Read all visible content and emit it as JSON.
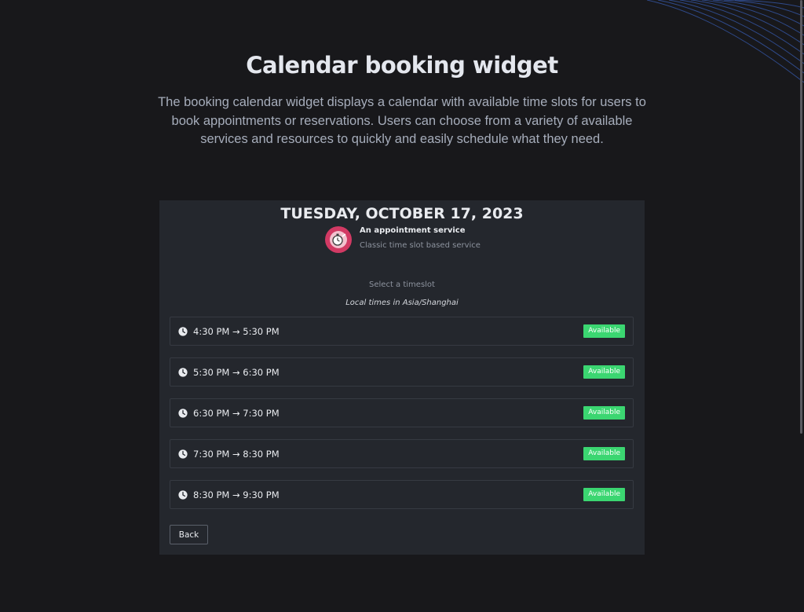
{
  "hero": {
    "title": "Calendar booking widget",
    "description": "The booking calendar widget displays a calendar with available time slots for users to book appointments or reservations. Users can choose from a variety of available services and resources to quickly and easily schedule what they need."
  },
  "widget": {
    "date_heading": "TUESDAY, OCTOBER 17, 2023",
    "service": {
      "name": "An appointment service",
      "subtitle": "Classic time slot based service",
      "avatar_icon": "stopwatch-icon",
      "avatar_color": "#d23a64"
    },
    "select_label": "Select a timeslot",
    "timezone_label": "Local times in Asia/Shanghai",
    "slots": [
      {
        "time": "4:30 PM → 5:30 PM",
        "status": "Available"
      },
      {
        "time": "5:30 PM → 6:30 PM",
        "status": "Available"
      },
      {
        "time": "6:30 PM → 7:30 PM",
        "status": "Available"
      },
      {
        "time": "7:30 PM → 8:30 PM",
        "status": "Available"
      },
      {
        "time": "8:30 PM → 9:30 PM",
        "status": "Available"
      }
    ],
    "back_label": "Back",
    "status_color": "#3bd671"
  },
  "colors": {
    "background": "#18181b",
    "widget_background": "#24272d",
    "decoration_lines": "#2f4a8a"
  }
}
